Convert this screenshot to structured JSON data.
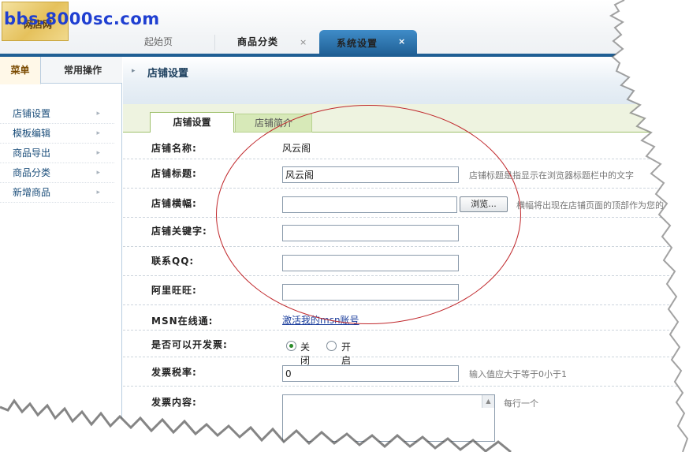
{
  "header": {
    "logo_text": "网店网",
    "watermark": "bbs.8000sc.com",
    "tabs": [
      {
        "label": "起始页"
      },
      {
        "label": "商品分类",
        "close": "×"
      },
      {
        "label": "系统设置",
        "close": "×"
      }
    ]
  },
  "sidebar": {
    "tabs": [
      {
        "label": "菜单"
      },
      {
        "label": "常用操作"
      }
    ],
    "items": [
      {
        "label": "店铺设置"
      },
      {
        "label": "模板编辑"
      },
      {
        "label": "商品导出"
      },
      {
        "label": "商品分类"
      },
      {
        "label": "新增商品"
      }
    ]
  },
  "main": {
    "title": "店铺设置",
    "subtabs": [
      {
        "label": "店铺设置"
      },
      {
        "label": "店铺简介"
      }
    ],
    "fields": {
      "shop_name": {
        "label": "店铺名称:",
        "value": "风云阁"
      },
      "shop_title": {
        "label": "店铺标题:",
        "value": "风云阁",
        "hint": "店铺标题是指显示在浏览器标题栏中的文字"
      },
      "banner": {
        "label": "店铺横幅:",
        "value": "",
        "button": "浏览...",
        "hint": "横幅将出现在店铺页面的顶部作为您的"
      },
      "keywords": {
        "label": "店铺关键字:",
        "value": ""
      },
      "qq": {
        "label": "联系QQ:",
        "value": ""
      },
      "wangwang": {
        "label": "阿里旺旺:",
        "value": ""
      },
      "msn": {
        "label": "MSN在线通:",
        "link": "激活我的msn账号"
      },
      "invoice": {
        "label": "是否可以开发票:",
        "options": [
          "关闭",
          "开启"
        ],
        "selected": "关闭"
      },
      "tax_rate": {
        "label": "发票税率:",
        "value": "0",
        "hint": "输入值应大于等于0小于1"
      },
      "invoice_content": {
        "label": "发票内容:",
        "hint": "每行一个"
      }
    }
  }
}
